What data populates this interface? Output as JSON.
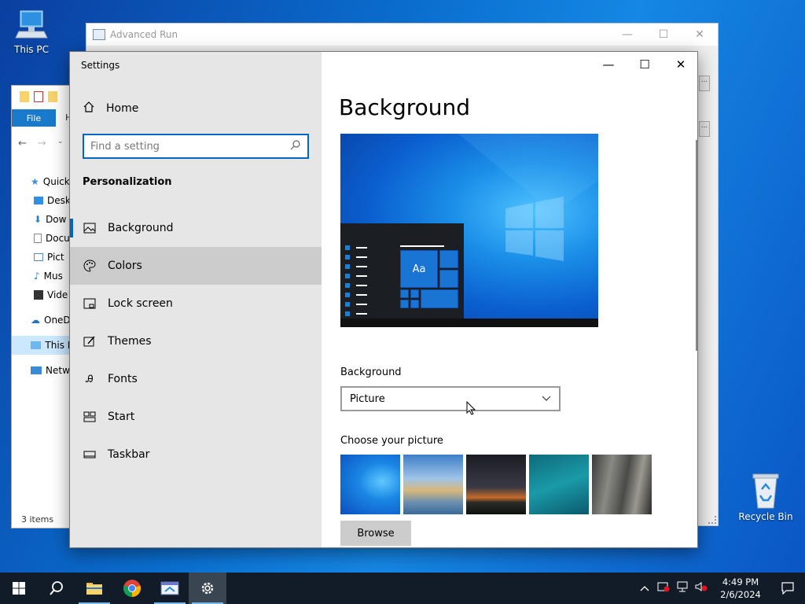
{
  "desktop": {
    "icons": [
      {
        "label": "This PC"
      },
      {
        "label": "Recycle Bin"
      }
    ]
  },
  "advanced_run": {
    "title": "Advanced Run",
    "side_button": "..."
  },
  "explorer": {
    "file_tab": "File",
    "ribbon_hidden": "H",
    "tree": [
      "Quick",
      "Desk",
      "Dow",
      "Docu",
      "Pict",
      "Mus",
      "Vide",
      "OneD",
      "This P",
      "Netw"
    ],
    "status": "3 items"
  },
  "settings": {
    "window_title": "Settings",
    "home_label": "Home",
    "search_placeholder": "Find a setting",
    "section_title": "Personalization",
    "nav": [
      {
        "label": "Background",
        "icon": "image-icon"
      },
      {
        "label": "Colors",
        "icon": "palette-icon"
      },
      {
        "label": "Lock screen",
        "icon": "lock-screen-icon"
      },
      {
        "label": "Themes",
        "icon": "themes-icon"
      },
      {
        "label": "Fonts",
        "icon": "fonts-icon"
      },
      {
        "label": "Start",
        "icon": "start-icon"
      },
      {
        "label": "Taskbar",
        "icon": "taskbar-icon"
      }
    ],
    "content": {
      "page_title": "Background",
      "preview_tile_text": "Aa",
      "background_label": "Background",
      "background_value": "Picture",
      "choose_label": "Choose your picture",
      "browse_label": "Browse"
    }
  },
  "taskbar": {
    "clock_time": "4:49 PM",
    "clock_date": "2/6/2024"
  },
  "colors": {
    "accent": "#0067c0",
    "sidebar_bg": "#e6e6e6",
    "hover_bg": "#cccccc",
    "taskbar_bg": "#111c28"
  }
}
